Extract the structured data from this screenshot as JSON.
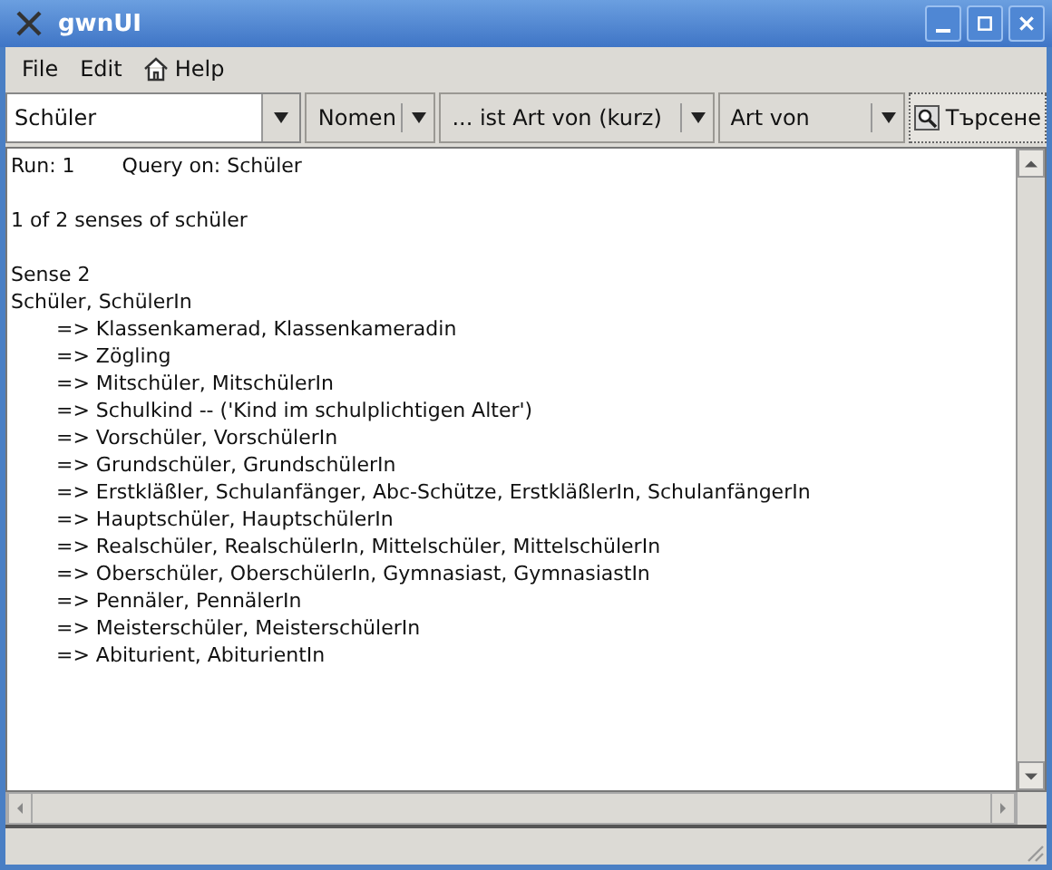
{
  "window": {
    "title": "gwnUI"
  },
  "menu": [
    {
      "label": "File",
      "icon": false
    },
    {
      "label": "Edit",
      "icon": false
    },
    {
      "label": "Help",
      "icon": true
    }
  ],
  "toolbar": {
    "query": "Schüler",
    "part_of_speech": "Nomen",
    "relation": "... ist Art von (kurz)",
    "relation_type": "Art von",
    "search_button": "Търсене"
  },
  "output": {
    "run": "Run: 1",
    "query": "Query on: Schüler",
    "summary": "1 of 2 senses of schüler",
    "sense": "Sense 2",
    "head": "Schüler, SchülerIn",
    "children": [
      {
        "text": "=> Klassenkamerad, Klassenkameradin"
      },
      {
        "text": "=> Zögling"
      },
      {
        "text": "=> Mitschüler, MitschülerIn"
      },
      {
        "text": "=> Schulkind -- ('Kind im schulplichtigen Alter')"
      },
      {
        "text": "=> Vorschüler, VorschülerIn"
      },
      {
        "text": "=> Grundschüler, GrundschülerIn"
      },
      {
        "text": "=> Erstkläßler, Schulanfänger, Abc-Schütze, ErstkläßlerIn, SchulanfängerIn"
      },
      {
        "text": "=> Hauptschüler, HauptschülerIn"
      },
      {
        "text": "=> Realschüler, RealschülerIn, Mittelschüler, MittelschülerIn"
      },
      {
        "text": "=> Oberschüler, OberschülerIn, Gymnasiast, GymnasiastIn"
      },
      {
        "text": "=> Pennäler, PennälerIn"
      },
      {
        "text": "=> Meisterschüler, MeisterschülerIn"
      },
      {
        "text": "=> Abiturient, AbiturientIn"
      }
    ]
  }
}
